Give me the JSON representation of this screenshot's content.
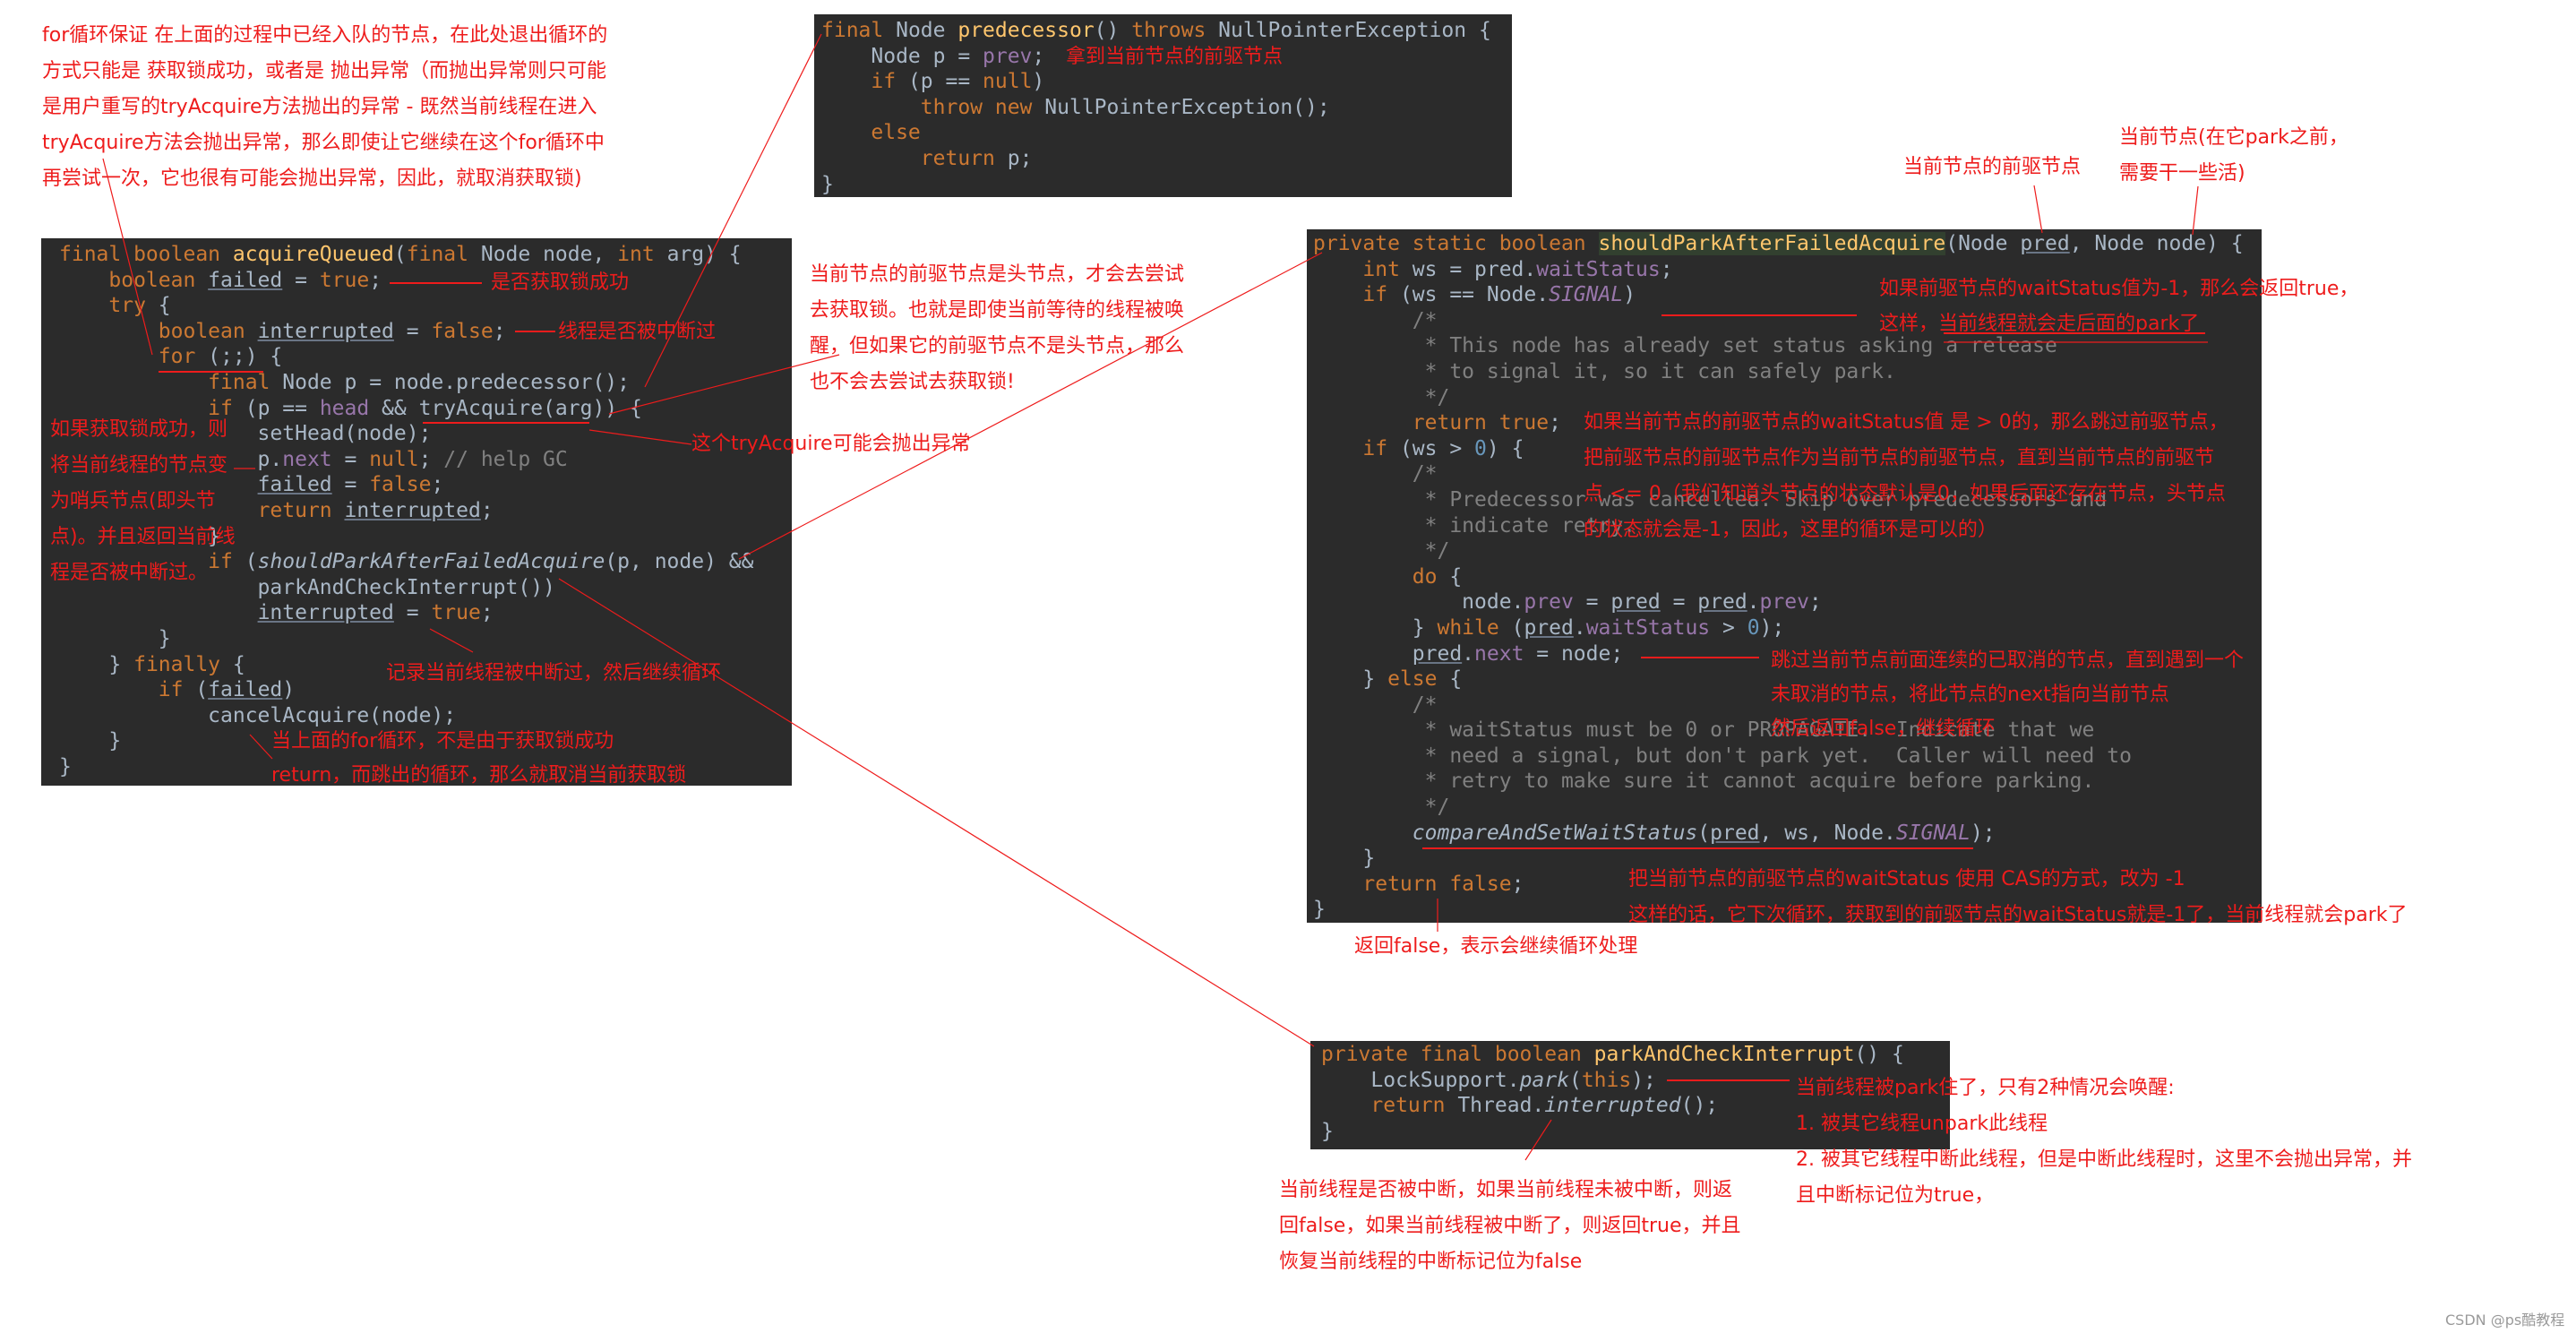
{
  "colors": {
    "code_bg": "#2b2b2b",
    "keyword": "#cc7832",
    "text": "#a9b7c6",
    "method": "#ffc66d",
    "field": "#9876aa",
    "comment": "#808080",
    "number": "#6897bb",
    "annotation": "#ee1c1c"
  },
  "code_blocks": {
    "acquireQueued": [
      [
        [
          "k",
          "final boolean "
        ],
        [
          "m",
          "acquireQueued"
        ],
        [
          "t",
          "("
        ],
        [
          "k",
          "final "
        ],
        [
          "t",
          "Node node, "
        ],
        [
          "k",
          "int "
        ],
        [
          "t",
          "arg) {"
        ]
      ],
      [
        [
          "t",
          "    "
        ],
        [
          "k",
          "boolean "
        ],
        [
          "u",
          "failed"
        ],
        [
          "t",
          " = "
        ],
        [
          "k",
          "true"
        ],
        [
          "t",
          ";"
        ]
      ],
      [
        [
          "t",
          "    "
        ],
        [
          "k",
          "try "
        ],
        [
          "t",
          "{"
        ]
      ],
      [
        [
          "t",
          "        "
        ],
        [
          "k",
          "boolean "
        ],
        [
          "u",
          "interrupted"
        ],
        [
          "t",
          " = "
        ],
        [
          "k",
          "false"
        ],
        [
          "t",
          ";"
        ]
      ],
      [
        [
          "t",
          "        "
        ],
        [
          "k",
          "for "
        ],
        [
          "t",
          "(;;) {"
        ]
      ],
      [
        [
          "t",
          "            "
        ],
        [
          "k",
          "final "
        ],
        [
          "t",
          "Node p = node.predecessor();"
        ]
      ],
      [
        [
          "t",
          "            "
        ],
        [
          "k",
          "if "
        ],
        [
          "t",
          "(p == "
        ],
        [
          "f",
          "head"
        ],
        [
          "t",
          " && tryAcquire(arg)) {"
        ]
      ],
      [
        [
          "t",
          "                setHead(node);"
        ]
      ],
      [
        [
          "t",
          "                p."
        ],
        [
          "f",
          "next"
        ],
        [
          "t",
          " = "
        ],
        [
          "k",
          "null"
        ],
        [
          "t",
          "; "
        ],
        [
          "c",
          "// help GC"
        ]
      ],
      [
        [
          "t",
          "                "
        ],
        [
          "u",
          "failed"
        ],
        [
          "t",
          " = "
        ],
        [
          "k",
          "false"
        ],
        [
          "t",
          ";"
        ]
      ],
      [
        [
          "t",
          "                "
        ],
        [
          "k",
          "return "
        ],
        [
          "u",
          "interrupted"
        ],
        [
          "t",
          ";"
        ]
      ],
      [
        [
          "t",
          "            }"
        ]
      ],
      [
        [
          "t",
          "            "
        ],
        [
          "k",
          "if "
        ],
        [
          "t",
          "("
        ],
        [
          "i",
          "shouldParkAfterFailedAcquire"
        ],
        [
          "t",
          "(p, node) &&"
        ]
      ],
      [
        [
          "t",
          "                parkAndCheckInterrupt())"
        ]
      ],
      [
        [
          "t",
          "                "
        ],
        [
          "u",
          "interrupted"
        ],
        [
          "t",
          " = "
        ],
        [
          "k",
          "true"
        ],
        [
          "t",
          ";"
        ]
      ],
      [
        [
          "t",
          "        }"
        ]
      ],
      [
        [
          "t",
          "    } "
        ],
        [
          "k",
          "finally "
        ],
        [
          "t",
          "{"
        ]
      ],
      [
        [
          "t",
          "        "
        ],
        [
          "k",
          "if "
        ],
        [
          "t",
          "("
        ],
        [
          "u",
          "failed"
        ],
        [
          "t",
          ")"
        ]
      ],
      [
        [
          "t",
          "            cancelAcquire(node);"
        ]
      ],
      [
        [
          "t",
          "    }"
        ]
      ],
      [
        [
          "t",
          "}"
        ]
      ]
    ],
    "predecessor": [
      [
        [
          "k",
          "final "
        ],
        [
          "t",
          "Node "
        ],
        [
          "m",
          "predecessor"
        ],
        [
          "t",
          "() "
        ],
        [
          "k",
          "throws "
        ],
        [
          "t",
          "NullPointerException {"
        ]
      ],
      [
        [
          "t",
          "    Node p = "
        ],
        [
          "f",
          "prev"
        ],
        [
          "t",
          ";"
        ]
      ],
      [
        [
          "t",
          "    "
        ],
        [
          "k",
          "if "
        ],
        [
          "t",
          "(p == "
        ],
        [
          "k",
          "null"
        ],
        [
          "t",
          ")"
        ]
      ],
      [
        [
          "t",
          "        "
        ],
        [
          "k",
          "throw new "
        ],
        [
          "t",
          "NullPointerException();"
        ]
      ],
      [
        [
          "t",
          "    "
        ],
        [
          "k",
          "else"
        ]
      ],
      [
        [
          "t",
          "        "
        ],
        [
          "k",
          "return "
        ],
        [
          "t",
          "p;"
        ]
      ],
      [
        [
          "t",
          "}"
        ]
      ]
    ],
    "shouldPark": [
      [
        [
          "k",
          "private static boolean "
        ],
        [
          "h",
          "shouldParkAfterFailedAcquire"
        ],
        [
          "t",
          "(Node "
        ],
        [
          "u",
          "pred"
        ],
        [
          "t",
          ", Node node) {"
        ]
      ],
      [
        [
          "t",
          "    "
        ],
        [
          "k",
          "int "
        ],
        [
          "t",
          "ws = pred."
        ],
        [
          "f",
          "waitStatus"
        ],
        [
          "t",
          ";"
        ]
      ],
      [
        [
          "t",
          "    "
        ],
        [
          "k",
          "if "
        ],
        [
          "t",
          "(ws == Node."
        ],
        [
          "fi",
          "SIGNAL"
        ],
        [
          "t",
          ")"
        ]
      ],
      [
        [
          "c",
          "        /*"
        ]
      ],
      [
        [
          "c",
          "         * This node has already set status asking a release"
        ]
      ],
      [
        [
          "c",
          "         * to signal it, so it can safely park."
        ]
      ],
      [
        [
          "c",
          "         */"
        ]
      ],
      [
        [
          "t",
          "        "
        ],
        [
          "k",
          "return true"
        ],
        [
          "t",
          ";"
        ]
      ],
      [
        [
          "t",
          "    "
        ],
        [
          "k",
          "if "
        ],
        [
          "t",
          "(ws > "
        ],
        [
          "n",
          "0"
        ],
        [
          "t",
          ") {"
        ]
      ],
      [
        [
          "c",
          "        /*"
        ]
      ],
      [
        [
          "c",
          "         * Predecessor was cancelled. Skip over predecessors and"
        ]
      ],
      [
        [
          "c",
          "         * indicate retry."
        ]
      ],
      [
        [
          "c",
          "         */"
        ]
      ],
      [
        [
          "t",
          "        "
        ],
        [
          "k",
          "do "
        ],
        [
          "t",
          "{"
        ]
      ],
      [
        [
          "t",
          "            node."
        ],
        [
          "f",
          "prev"
        ],
        [
          "t",
          " = "
        ],
        [
          "u",
          "pred"
        ],
        [
          "t",
          " = "
        ],
        [
          "u",
          "pred"
        ],
        [
          "t",
          "."
        ],
        [
          "f",
          "prev"
        ],
        [
          "t",
          ";"
        ]
      ],
      [
        [
          "t",
          "        } "
        ],
        [
          "k",
          "while "
        ],
        [
          "t",
          "("
        ],
        [
          "u",
          "pred"
        ],
        [
          "t",
          "."
        ],
        [
          "f",
          "waitStatus"
        ],
        [
          "t",
          " > "
        ],
        [
          "n",
          "0"
        ],
        [
          "t",
          ");"
        ]
      ],
      [
        [
          "t",
          "        "
        ],
        [
          "u",
          "pred"
        ],
        [
          "t",
          "."
        ],
        [
          "f",
          "next"
        ],
        [
          "t",
          " = node;"
        ]
      ],
      [
        [
          "t",
          "    } "
        ],
        [
          "k",
          "else "
        ],
        [
          "t",
          "{"
        ]
      ],
      [
        [
          "c",
          "        /*"
        ]
      ],
      [
        [
          "c",
          "         * waitStatus must be 0 or PROPAGATE.  Indicate that we"
        ]
      ],
      [
        [
          "c",
          "         * need a signal, but don't park yet.  Caller will need to"
        ]
      ],
      [
        [
          "c",
          "         * retry to make sure it cannot acquire before parking."
        ]
      ],
      [
        [
          "c",
          "         */"
        ]
      ],
      [
        [
          "t",
          "        "
        ],
        [
          "i",
          "compareAndSetWaitStatus"
        ],
        [
          "t",
          "("
        ],
        [
          "u",
          "pred"
        ],
        [
          "t",
          ", ws, Node."
        ],
        [
          "fi",
          "SIGNAL"
        ],
        [
          "t",
          ");"
        ]
      ],
      [
        [
          "t",
          "    }"
        ]
      ],
      [
        [
          "t",
          "    "
        ],
        [
          "k",
          "return false"
        ],
        [
          "t",
          ";"
        ]
      ],
      [
        [
          "t",
          "}"
        ]
      ]
    ],
    "parkAndCheckInterrupt": [
      [
        [
          "k",
          "private final boolean "
        ],
        [
          "m",
          "parkAndCheckInterrupt"
        ],
        [
          "t",
          "() {"
        ]
      ],
      [
        [
          "t",
          "    LockSupport."
        ],
        [
          "i",
          "park"
        ],
        [
          "t",
          "("
        ],
        [
          "k",
          "this"
        ],
        [
          "t",
          ");"
        ]
      ],
      [
        [
          "t",
          "    "
        ],
        [
          "k",
          "return "
        ],
        [
          "t",
          "Thread."
        ],
        [
          "i",
          "interrupted"
        ],
        [
          "t",
          "();"
        ]
      ],
      [
        [
          "t",
          "}"
        ]
      ]
    ]
  },
  "annotations": {
    "for_loop_note": [
      "for循环保证 在上面的过程中已经入队的节点，在此处退出循环的",
      "方式只能是 获取锁成功，或者是 抛出异常（而抛出异常则只可能",
      "是用户重写的tryAcquire方法抛出的异常 - 既然当前线程在进入",
      "tryAcquire方法会抛出异常，那么即使让它继续在这个for循环中",
      "再尝试一次，它也很有可能会抛出异常，因此，就取消获取锁)"
    ],
    "failed_note": "是否获取锁成功",
    "interrupted_note": "线程是否被中断过",
    "try_acquire_note": "这个tryAcquire可能会抛出异常",
    "acquire_success_note": [
      "如果获取锁成功，则",
      "将当前线程的节点变",
      "为哨兵节点(即头节",
      "点)。并且返回当前线",
      "程是否被中断过。"
    ],
    "record_interrupt_note": "记录当前线程被中断过，然后继续循环",
    "cancel_note": [
      "当上面的for循环，不是由于获取锁成功",
      "return，而跳出的循环，那么就取消当前获取锁"
    ],
    "prev_note": "拿到当前节点的前驱节点",
    "head_note": [
      "当前节点的前驱节点是头节点，才会去尝试",
      "去获取锁。也就是即使当前等待的线程被唤",
      "醒，但如果它的前驱节点不是头节点，那么",
      "也不会去尝试去获取锁!"
    ],
    "pred_param_note": "当前节点的前驱节点",
    "node_param_note": [
      "当前节点(在它park之前，",
      "需要干一些活)"
    ],
    "signal_note": [
      "如果前驱节点的waitStatus值为-1，那么会返回true，",
      "这样，当前线程就会走后面的park了"
    ],
    "cancelled_note": [
      "如果当前节点的前驱节点的waitStatus值 是 > 0的，那么跳过前驱节点，",
      "把前驱节点的前驱节点作为当前节点的前驱节点，直到当前节点的前驱节",
      "点 <= 0（我们知道头节点的状态默认是0，如果后面还存在节点，头节点",
      "的状态就会是-1，因此，这里的循环是可以的）"
    ],
    "skip_note": [
      "跳过当前节点前面连续的已取消的节点，直到遇到一个",
      "未取消的节点，将此节点的next指向当前节点",
      "然后返回false，继续循环"
    ],
    "cas_note": [
      "把当前节点的前驱节点的waitStatus 使用 CAS的方式，改为 -1",
      "这样的话，它下次循环，获取到的前驱节点的waitStatus就是-1了，当前线程就会park了"
    ],
    "return_false_note": "返回false，表示会继续循环处理",
    "park_note": [
      "当前线程被park住了，只有2种情况会唤醒:",
      "1. 被其它线程unpark此线程",
      "2. 被其它线程中断此线程，但是中断此线程时，这里不会抛出异常，并",
      "且中断标记位为true，"
    ],
    "interrupted_return_note": [
      "当前线程是否被中断，如果当前线程未被中断，则返",
      "回false，如果当前线程被中断了，则返回true，并且",
      "恢复当前线程的中断标记位为false"
    ]
  },
  "watermark": "CSDN @ps酷教程"
}
